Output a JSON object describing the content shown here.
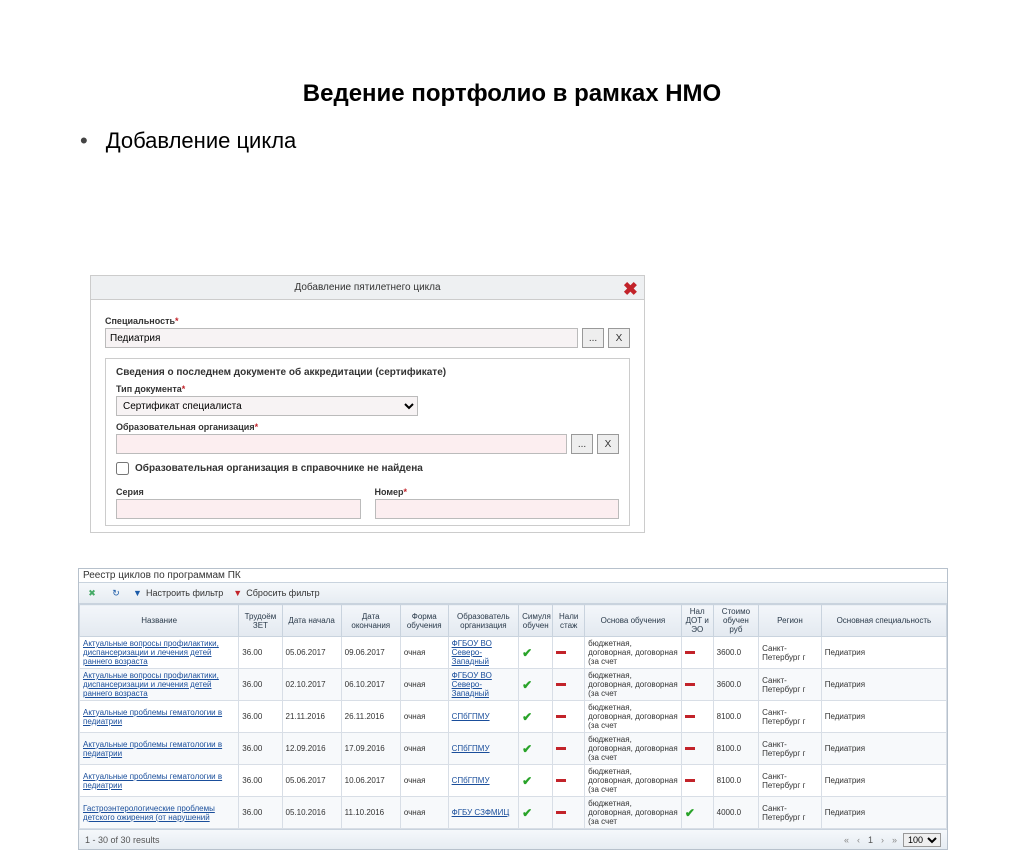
{
  "slide": {
    "title": "Ведение портфолио в рамках НМО",
    "bullet": "Добавление цикла"
  },
  "dialog": {
    "title": "Добавление пятилетнего цикла",
    "specialty_label": "Специальность",
    "specialty_value": "Педиатрия",
    "more_btn": "...",
    "clear_btn": "X",
    "section_title": "Сведения о последнем документе об аккредитации (сертификате)",
    "doc_type_label": "Тип документа",
    "doc_type_value": "Сертификат специалиста",
    "org_label": "Образовательная организация",
    "org_value": "",
    "not_found_label": "Образовательная организация в справочнике не найдена",
    "series_label": "Серия",
    "number_label": "Номер"
  },
  "grid": {
    "title": "Реестр циклов по программам ПК",
    "filter_setup": "Настроить фильтр",
    "filter_reset": "Сбросить фильтр",
    "columns": {
      "name": "Название",
      "zet": "Трудоём ЗЕТ",
      "start": "Дата начала",
      "end": "Дата окончания",
      "form": "Форма обучения",
      "org": "Образователь организация",
      "sim": "Симуля обучен",
      "staz": "Нали стаж",
      "basis": "Основа обучения",
      "dot": "Нал ДОТ и ЭО",
      "cost": "Стоимо обучен руб",
      "region": "Регион",
      "spec": "Основная специальность"
    },
    "rows": [
      {
        "name": "Актуальные вопросы профилактики, диспансеризации и лечения детей раннего возраста",
        "zet": "36.00",
        "start": "05.06.2017",
        "end": "09.06.2017",
        "form": "очная",
        "org": "ФГБОУ ВО Северо-Западный",
        "sim": true,
        "staz": false,
        "basis": "бюджетная, договорная, договорная (за счет",
        "dot": false,
        "cost": "3600.0",
        "region": "Санкт-Петербург г",
        "spec": "Педиатрия"
      },
      {
        "name": "Актуальные вопросы профилактики, диспансеризации и лечения детей раннего возраста",
        "zet": "36.00",
        "start": "02.10.2017",
        "end": "06.10.2017",
        "form": "очная",
        "org": "ФГБОУ ВО Северо-Западный",
        "sim": true,
        "staz": false,
        "basis": "бюджетная, договорная, договорная (за счет",
        "dot": false,
        "cost": "3600.0",
        "region": "Санкт-Петербург г",
        "spec": "Педиатрия"
      },
      {
        "name": "Актуальные проблемы гематологии в педиатрии",
        "zet": "36.00",
        "start": "21.11.2016",
        "end": "26.11.2016",
        "form": "очная",
        "org": "СПбГПМУ",
        "sim": true,
        "staz": false,
        "basis": "бюджетная, договорная, договорная (за счет",
        "dot": false,
        "cost": "8100.0",
        "region": "Санкт-Петербург г",
        "spec": "Педиатрия"
      },
      {
        "name": "Актуальные проблемы гематологии в педиатрии",
        "zet": "36.00",
        "start": "12.09.2016",
        "end": "17.09.2016",
        "form": "очная",
        "org": "СПбГПМУ",
        "sim": true,
        "staz": false,
        "basis": "бюджетная, договорная, договорная (за счет",
        "dot": false,
        "cost": "8100.0",
        "region": "Санкт-Петербург г",
        "spec": "Педиатрия"
      },
      {
        "name": "Актуальные проблемы гематологии в педиатрии",
        "zet": "36.00",
        "start": "05.06.2017",
        "end": "10.06.2017",
        "form": "очная",
        "org": "СПбГПМУ",
        "sim": true,
        "staz": false,
        "basis": "бюджетная, договорная, договорная (за счет",
        "dot": false,
        "cost": "8100.0",
        "region": "Санкт-Петербург г",
        "spec": "Педиатрия"
      },
      {
        "name": "Гастроэнтерологические проблемы детского ожирения (от нарушений",
        "zet": "36.00",
        "start": "05.10.2016",
        "end": "11.10.2016",
        "form": "очная",
        "org": "ФГБУ СЗФМИЦ",
        "sim": true,
        "staz": false,
        "basis": "бюджетная, договорная, договорная (за счет",
        "dot": true,
        "cost": "4000.0",
        "region": "Санкт-Петербург г",
        "spec": "Педиатрия"
      }
    ],
    "footer": {
      "results": "1 - 30 of 30 results",
      "page": "1",
      "per_page": "100"
    }
  }
}
